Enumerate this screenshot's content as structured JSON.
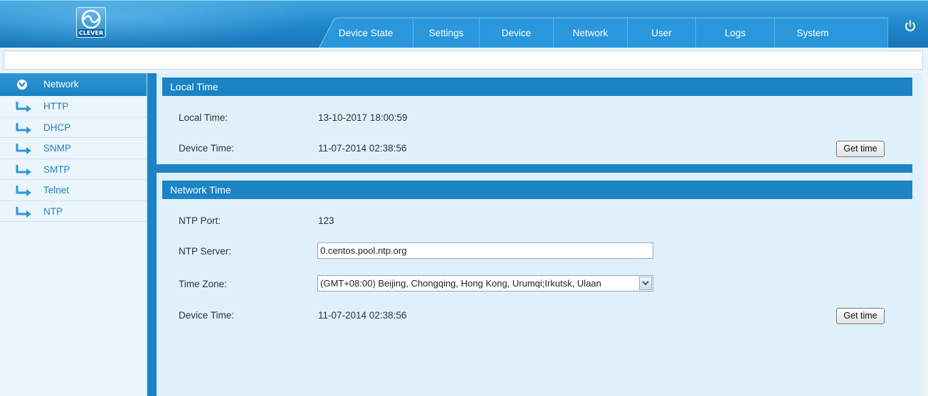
{
  "header": {
    "logo_text": "CLEVER",
    "nav": [
      "Device State",
      "Settings",
      "Device",
      "Network",
      "User",
      "Logs",
      "System"
    ],
    "power_icon": "power-icon"
  },
  "sidebar": {
    "head": "Network",
    "items": [
      "HTTP",
      "DHCP",
      "SNMP",
      "SMTP",
      "Telnet",
      "NTP"
    ]
  },
  "local_time": {
    "title": "Local Time",
    "local_label": "Local Time:",
    "local_value": "13-10-2017 18:00:59",
    "device_label": "Device Time:",
    "device_value": "11-07-2014 02:38:56",
    "button": "Get time"
  },
  "network_time": {
    "title": "Network Time",
    "port_label": "NTP Port:",
    "port_value": "123",
    "server_label": "NTP Server:",
    "server_value": "0.centos.pool.ntp.org",
    "zone_label": "Time Zone:",
    "zone_value": "(GMT+08:00) Beijing, Chongqing, Hong Kong, Urumqi;Irkutsk, Ulaan",
    "device_label": "Device Time:",
    "device_value": "11-07-2014 02:38:56",
    "button": "Get time"
  },
  "colors": {
    "header": "#1f86c8",
    "accent": "#1c83c5",
    "content_bg": "#dff0fb",
    "sidebar_bg": "#eaf5fc"
  }
}
